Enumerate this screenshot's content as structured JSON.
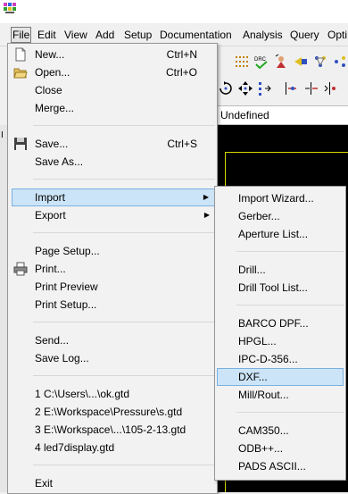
{
  "menubar": {
    "items": [
      {
        "label": "File",
        "name": "menu-file"
      },
      {
        "label": "Edit",
        "name": "menu-edit"
      },
      {
        "label": "View",
        "name": "menu-view"
      },
      {
        "label": "Add",
        "name": "menu-add"
      },
      {
        "label": "Setup",
        "name": "menu-setup"
      },
      {
        "label": "Documentation",
        "name": "menu-documentation"
      },
      {
        "label": "Analysis",
        "name": "menu-analysis"
      },
      {
        "label": "Query",
        "name": "menu-query"
      },
      {
        "label": "Opti",
        "name": "menu-options"
      }
    ]
  },
  "status": {
    "layer_label": "Undefined"
  },
  "left_strip_label": "I",
  "file_menu": {
    "items": [
      {
        "label": "New...",
        "shortcut": "Ctrl+N"
      },
      {
        "label": "Open...",
        "shortcut": "Ctrl+O"
      },
      {
        "label": "Close",
        "shortcut": ""
      },
      {
        "label": "Merge...",
        "shortcut": ""
      },
      {
        "label": "Save...",
        "shortcut": "Ctrl+S"
      },
      {
        "label": "Save As...",
        "shortcut": ""
      },
      {
        "label": "Import",
        "shortcut": ""
      },
      {
        "label": "Export",
        "shortcut": ""
      },
      {
        "label": "Page Setup...",
        "shortcut": ""
      },
      {
        "label": "Print...",
        "shortcut": ""
      },
      {
        "label": "Print Preview",
        "shortcut": ""
      },
      {
        "label": "Print Setup...",
        "shortcut": ""
      },
      {
        "label": "Send...",
        "shortcut": ""
      },
      {
        "label": "Save Log...",
        "shortcut": ""
      },
      {
        "label": "1 C:\\Users\\...\\ok.gtd",
        "shortcut": ""
      },
      {
        "label": "2 E:\\Workspace\\Pressure\\s.gtd",
        "shortcut": ""
      },
      {
        "label": "3 E:\\Workspace\\...\\105-2-13.gtd",
        "shortcut": ""
      },
      {
        "label": "4 led7display.gtd",
        "shortcut": ""
      },
      {
        "label": "Exit",
        "shortcut": ""
      }
    ]
  },
  "import_submenu": {
    "items": [
      {
        "label": "Import Wizard..."
      },
      {
        "label": "Gerber..."
      },
      {
        "label": "Aperture List..."
      },
      {
        "label": "Drill..."
      },
      {
        "label": "Drill Tool List..."
      },
      {
        "label": "BARCO DPF..."
      },
      {
        "label": "HPGL..."
      },
      {
        "label": "IPC-D-356..."
      },
      {
        "label": "DXF..."
      },
      {
        "label": "Mill/Rout..."
      },
      {
        "label": "CAM350..."
      },
      {
        "label": "ODB++..."
      },
      {
        "label": "PADS ASCII..."
      }
    ]
  },
  "colors": {
    "highlight": "#cce4f7",
    "highlight_border": "#7ab0e0",
    "canvas": "#000000",
    "board_outline": "#d8d800"
  }
}
